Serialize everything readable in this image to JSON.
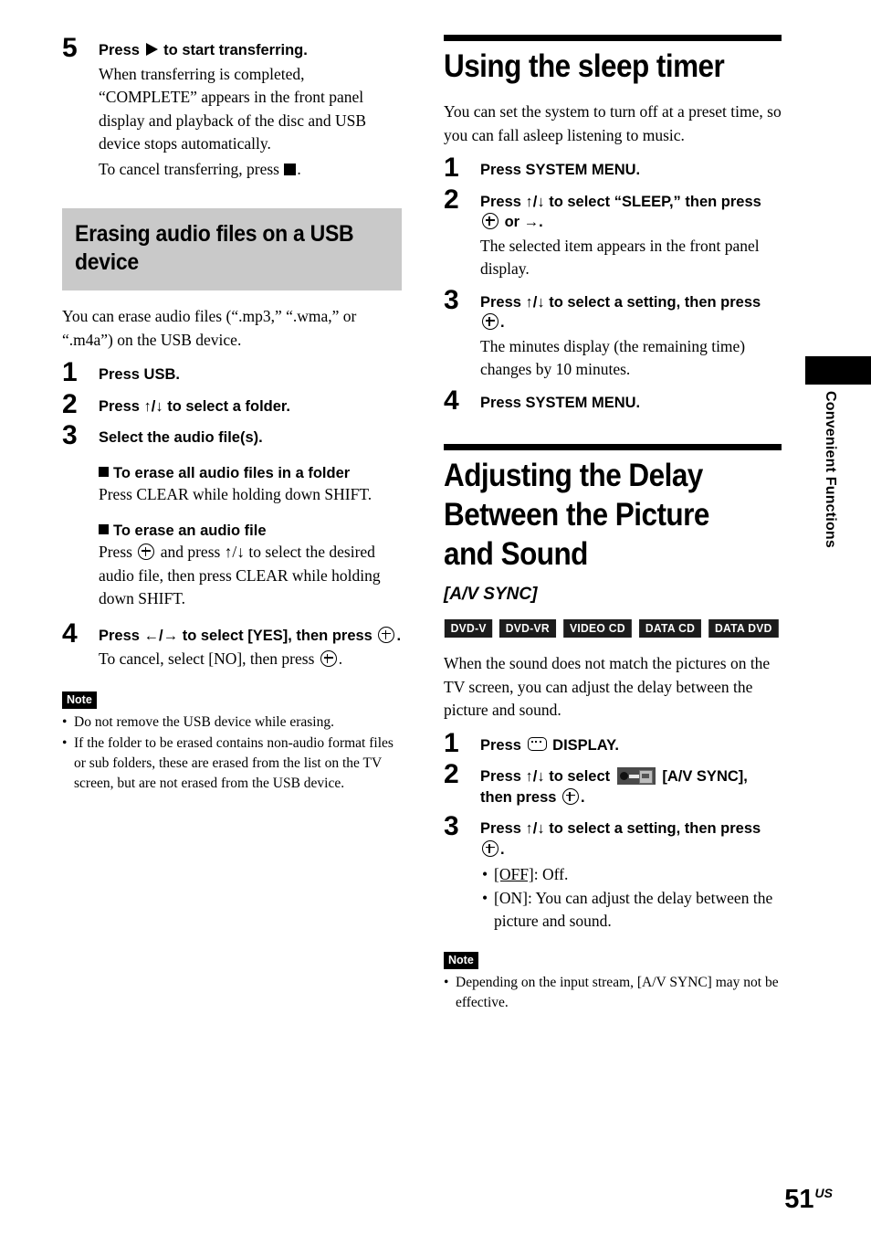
{
  "page": {
    "number": "51",
    "region_suffix": "US",
    "side_tab_label": "Convenient Functions"
  },
  "left_column": {
    "step5": {
      "num": "5",
      "title_before": "Press",
      "title_after": "to start transferring.",
      "body_line1": "When transferring is completed,",
      "body_line2": "“COMPLETE” appears in the front panel",
      "body_line3": "display and playback of the disc and USB",
      "body_line4": "device stops automatically.",
      "cancel_before": "To cancel transferring, press",
      "cancel_after": "."
    },
    "section_heading": "Erasing audio files on a USB device",
    "intro": "You can erase audio files (“.mp3,” “.wma,” or “.m4a”) on the USB device.",
    "steps": [
      {
        "num": "1",
        "title": "Press USB."
      },
      {
        "num": "2",
        "title": "Press ↑/↓ to select a folder."
      },
      {
        "num": "3",
        "title": "Select the audio file(s)."
      }
    ],
    "sub_all": {
      "heading": "To erase all audio files in a folder",
      "body": "Press CLEAR while holding down SHIFT."
    },
    "sub_one": {
      "heading": "To erase an audio file",
      "body_before": "Press",
      "body_after": "and press ↑/↓ to select the desired audio file, then press CLEAR while holding down SHIFT."
    },
    "step4": {
      "num": "4",
      "title_before": "Press ←/→ to select [YES], then press",
      "title_after": ".",
      "body_before": "To cancel, select [NO], then press",
      "body_after": "."
    },
    "note": {
      "label": "Note",
      "items": [
        "Do not remove the USB device while erasing.",
        "If the folder to be erased contains non-audio format files or sub folders, these are erased from the list on the TV screen, but are not erased from the USB device."
      ]
    }
  },
  "right_column": {
    "sleep_timer": {
      "heading": "Using the sleep timer",
      "intro": "You can set the system to turn off at a preset time, so you can fall asleep listening to music.",
      "step1": {
        "num": "1",
        "title": "Press SYSTEM MENU."
      },
      "step2": {
        "num": "2",
        "title_before": "Press ↑/↓ to select “SLEEP,” then press",
        "title_after": "or →.",
        "body": "The selected item appears in the front panel display."
      },
      "step3": {
        "num": "3",
        "title_before": "Press ↑/↓ to select a setting, then press",
        "title_after": ".",
        "body": "The minutes display (the remaining time) changes by 10 minutes."
      },
      "step4": {
        "num": "4",
        "title": "Press SYSTEM MENU."
      }
    },
    "av_sync": {
      "heading": "Adjusting the Delay Between the Picture and Sound",
      "subheading": "[A/V SYNC]",
      "badges": [
        "DVD-V",
        "DVD-VR",
        "VIDEO CD",
        "DATA CD",
        "DATA DVD"
      ],
      "intro": "When the sound does not match the pictures on the TV screen, you can adjust the delay between the picture and sound.",
      "step1": {
        "num": "1",
        "title_before": "Press",
        "title_after": "DISPLAY."
      },
      "step2": {
        "num": "2",
        "title_before": "Press ↑/↓ to select",
        "title_mid": "[A/V SYNC], then press",
        "title_after": "."
      },
      "step3": {
        "num": "3",
        "title_before": "Press ↑/↓ to select a setting, then press",
        "title_after": ".",
        "options": [
          {
            "key": "[OFF]",
            "text": ": Off."
          },
          {
            "key": "[ON]",
            "text": ": You can adjust the delay between the picture and sound."
          }
        ]
      },
      "note": {
        "label": "Note",
        "items": [
          "Depending on the input stream, [A/V SYNC] may not be effective."
        ]
      }
    }
  }
}
